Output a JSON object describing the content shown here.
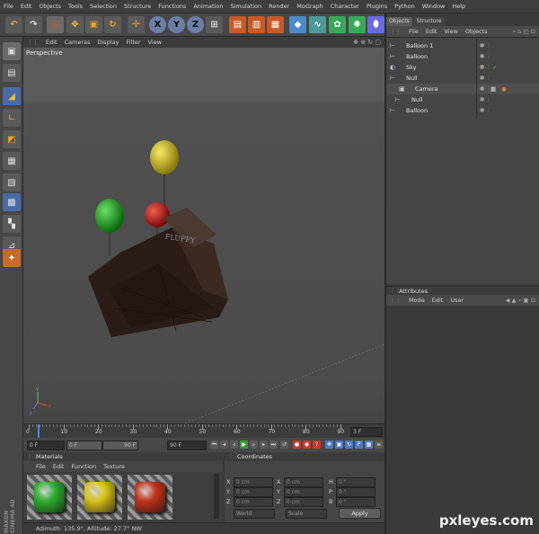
{
  "menu": [
    "File",
    "Edit",
    "Objects",
    "Tools",
    "Selection",
    "Structure",
    "Functions",
    "Animation",
    "Simulation",
    "Render",
    "MoGraph",
    "Character",
    "Plugins",
    "Python",
    "Window",
    "Help"
  ],
  "axis_buttons": {
    "x": "X",
    "y": "Y",
    "z": "Z"
  },
  "viewport": {
    "menu": [
      "Edit",
      "Cameras",
      "Display",
      "Filter",
      "View"
    ],
    "label": "Perspective",
    "house_sign": "FLUFFY",
    "axis_labels": {
      "x": "x",
      "y": "y",
      "z": "z"
    }
  },
  "timeline": {
    "ticks": [
      "0",
      "10",
      "20",
      "30",
      "40",
      "50",
      "60",
      "70",
      "80",
      "90"
    ],
    "current_frame": "3 F",
    "start_field": "0 F",
    "min_field": "0 F",
    "max_field": "90 F",
    "end_field": "90 F"
  },
  "right_panel": {
    "tabs": [
      "Objects",
      "Structure"
    ],
    "menu": [
      "File",
      "Edit",
      "View",
      "Objects"
    ],
    "objects": [
      {
        "label": "Balloon 1",
        "icon": "null-icon"
      },
      {
        "label": "Balloon",
        "icon": "null-icon"
      },
      {
        "label": "Sky",
        "icon": "sky-icon"
      },
      {
        "label": "Null",
        "icon": "null-icon"
      },
      {
        "label": "Camera",
        "icon": "camera-icon"
      },
      {
        "label": "Null",
        "icon": "null-icon"
      },
      {
        "label": "Balloon",
        "icon": "null-icon"
      }
    ]
  },
  "attributes": {
    "title": "Attributes",
    "menu": [
      "Mode",
      "Edit",
      "User"
    ]
  },
  "materials": {
    "title": "Materials",
    "menu": [
      "File",
      "Edit",
      "Function",
      "Texture"
    ],
    "swatches": [
      {
        "name": "green-material",
        "color": "#2fae2f"
      },
      {
        "name": "yellow-material",
        "color": "#d8c31a"
      },
      {
        "name": "red-material",
        "color": "#c4341c"
      }
    ]
  },
  "coordinates": {
    "title": "Coordinates",
    "rows": [
      {
        "a": "X",
        "av": "0 cm",
        "b": "X",
        "bv": "0 cm",
        "c": "H",
        "cv": "0 °"
      },
      {
        "a": "Y",
        "av": "0 cm",
        "b": "Y",
        "bv": "0 cm",
        "c": "P",
        "cv": "0 °"
      },
      {
        "a": "Z",
        "av": "0 cm",
        "b": "Z",
        "bv": "0 cm",
        "c": "B",
        "cv": "0 °"
      }
    ],
    "mode": "World",
    "scale": "Scale",
    "apply": "Apply"
  },
  "status": "Azimuth: 135.9°, Altitude: 27.7°  NW",
  "brand_vertical": "MAXON CINEMA 4D",
  "watermark": "pxleyes.com"
}
